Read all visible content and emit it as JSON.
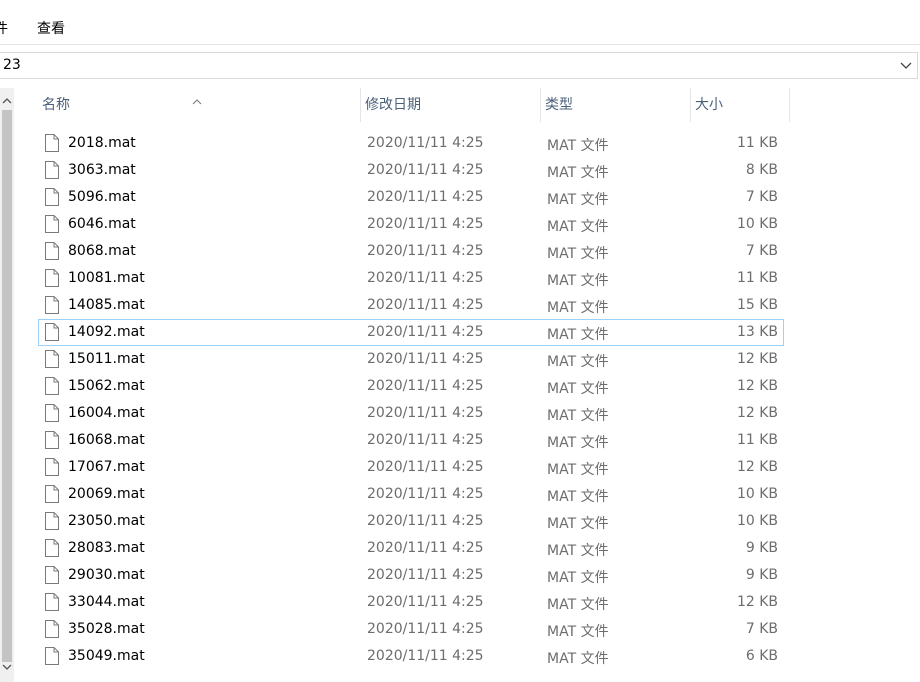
{
  "menubar": {
    "partial_label": "件",
    "view_label": "查看"
  },
  "address": {
    "path_text": "23"
  },
  "columns": {
    "name": "名称",
    "date": "修改日期",
    "type": "类型",
    "size": "大小"
  },
  "files": [
    {
      "name": "2018.mat",
      "date": "2020/11/11 4:25",
      "type": "MAT 文件",
      "size": "11 KB"
    },
    {
      "name": "3063.mat",
      "date": "2020/11/11 4:25",
      "type": "MAT 文件",
      "size": "8 KB"
    },
    {
      "name": "5096.mat",
      "date": "2020/11/11 4:25",
      "type": "MAT 文件",
      "size": "7 KB"
    },
    {
      "name": "6046.mat",
      "date": "2020/11/11 4:25",
      "type": "MAT 文件",
      "size": "10 KB"
    },
    {
      "name": "8068.mat",
      "date": "2020/11/11 4:25",
      "type": "MAT 文件",
      "size": "7 KB"
    },
    {
      "name": "10081.mat",
      "date": "2020/11/11 4:25",
      "type": "MAT 文件",
      "size": "11 KB"
    },
    {
      "name": "14085.mat",
      "date": "2020/11/11 4:25",
      "type": "MAT 文件",
      "size": "15 KB"
    },
    {
      "name": "14092.mat",
      "date": "2020/11/11 4:25",
      "type": "MAT 文件",
      "size": "13 KB"
    },
    {
      "name": "15011.mat",
      "date": "2020/11/11 4:25",
      "type": "MAT 文件",
      "size": "12 KB"
    },
    {
      "name": "15062.mat",
      "date": "2020/11/11 4:25",
      "type": "MAT 文件",
      "size": "12 KB"
    },
    {
      "name": "16004.mat",
      "date": "2020/11/11 4:25",
      "type": "MAT 文件",
      "size": "12 KB"
    },
    {
      "name": "16068.mat",
      "date": "2020/11/11 4:25",
      "type": "MAT 文件",
      "size": "11 KB"
    },
    {
      "name": "17067.mat",
      "date": "2020/11/11 4:25",
      "type": "MAT 文件",
      "size": "12 KB"
    },
    {
      "name": "20069.mat",
      "date": "2020/11/11 4:25",
      "type": "MAT 文件",
      "size": "10 KB"
    },
    {
      "name": "23050.mat",
      "date": "2020/11/11 4:25",
      "type": "MAT 文件",
      "size": "10 KB"
    },
    {
      "name": "28083.mat",
      "date": "2020/11/11 4:25",
      "type": "MAT 文件",
      "size": "9 KB"
    },
    {
      "name": "29030.mat",
      "date": "2020/11/11 4:25",
      "type": "MAT 文件",
      "size": "9 KB"
    },
    {
      "name": "33044.mat",
      "date": "2020/11/11 4:25",
      "type": "MAT 文件",
      "size": "12 KB"
    },
    {
      "name": "35028.mat",
      "date": "2020/11/11 4:25",
      "type": "MAT 文件",
      "size": "7 KB"
    },
    {
      "name": "35049.mat",
      "date": "2020/11/11 4:25",
      "type": "MAT 文件",
      "size": "6 KB"
    }
  ],
  "focused_row_index": 7,
  "icons": {
    "file": "file-icon",
    "sort": "sort-ascending-icon",
    "dropdown": "chevron-down-icon"
  },
  "colors": {
    "header_text": "#4c607a",
    "secondary_text": "#6d6d6d",
    "focus_border": "#99d1ff"
  }
}
